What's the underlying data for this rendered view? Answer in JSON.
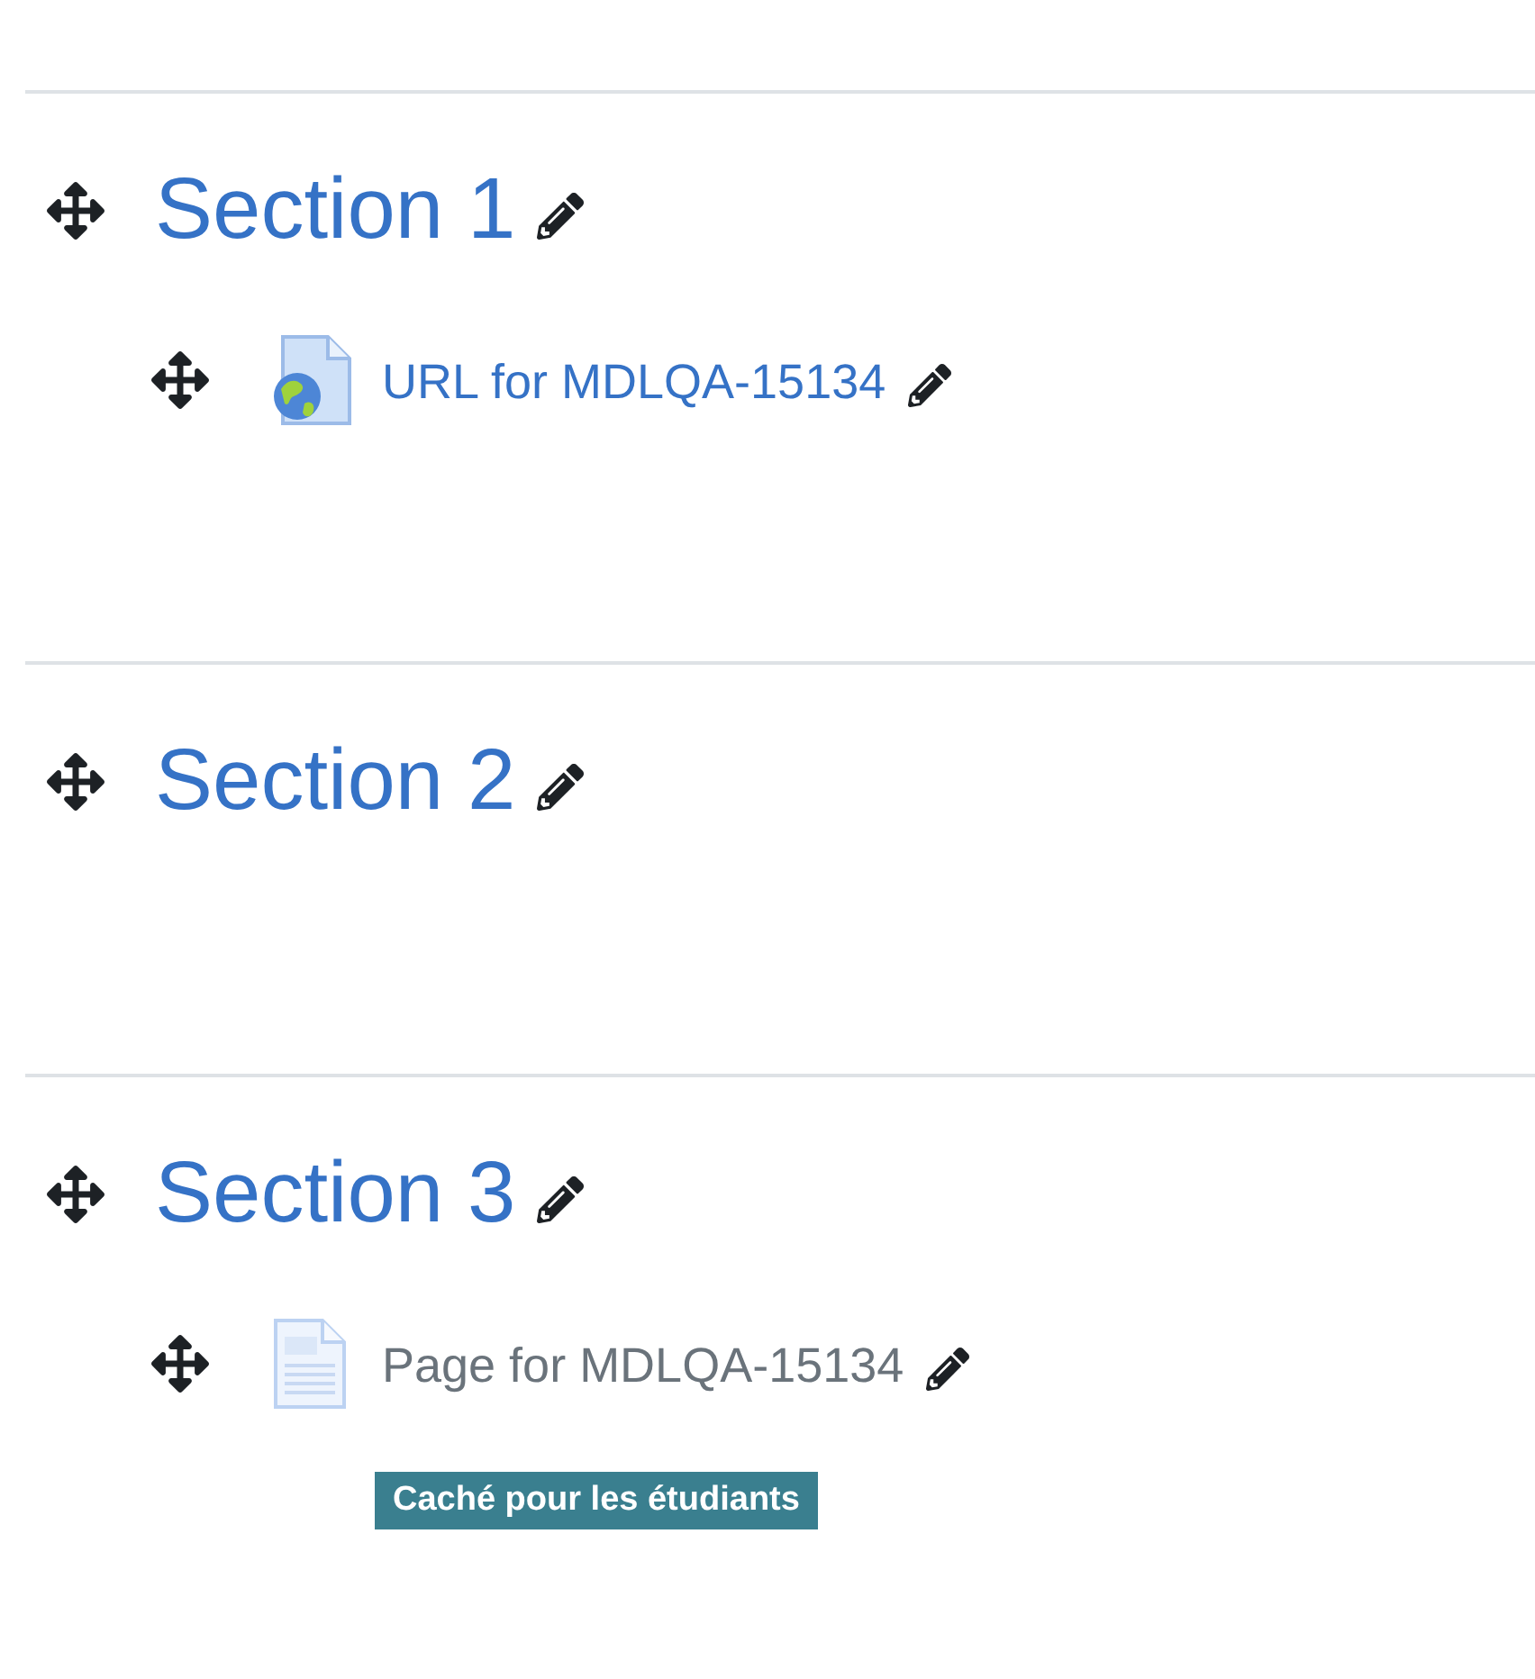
{
  "sections": [
    {
      "title": "Section 1",
      "activities": [
        {
          "kind": "url",
          "title": "URL for MDLQA-15134",
          "hidden": false
        }
      ]
    },
    {
      "title": "Section 2"
    },
    {
      "title": "Section 3",
      "activities": [
        {
          "kind": "page",
          "title": "Page for MDLQA-15134",
          "hidden": true,
          "badge": "Caché pour les étudiants"
        }
      ]
    }
  ]
}
